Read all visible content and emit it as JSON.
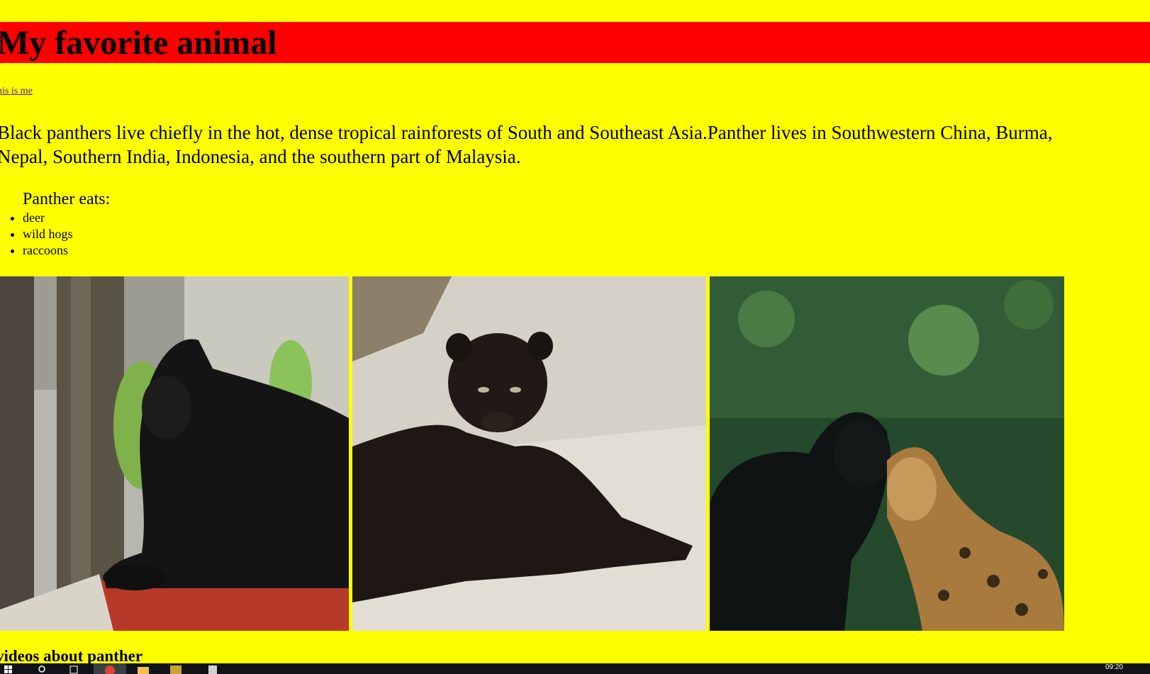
{
  "page": {
    "title": "My favorite animal",
    "link_text": "his is me",
    "paragraph": "Black panthers live chiefly in the hot, dense tropical rainforests of South and Southeast Asia.Panther lives in Southwestern China, Burma, Nepal, Southern India, Indonesia, and the southern part of Malaysia.",
    "eats_heading": "Panther eats:",
    "foods": [
      "deer",
      "wild hogs",
      "raccoons"
    ],
    "videos_heading": "videos about panther"
  },
  "photos": [
    {
      "subject": "black panther lying on a red ledge among trees"
    },
    {
      "subject": "black leopard lying on sandy ground"
    },
    {
      "subject": "black panther and jaguar snarling at each other"
    }
  ],
  "taskbar": {
    "clock": "09:20",
    "icons": [
      "start-icon",
      "search-icon",
      "task-view-icon",
      "chrome-icon",
      "file-explorer-icon",
      "app-icon",
      "app-icon-2"
    ]
  },
  "colors": {
    "background": "#ffff00",
    "title_bar": "#ff0000",
    "link": "#551a8b",
    "taskbar": "#101418"
  }
}
